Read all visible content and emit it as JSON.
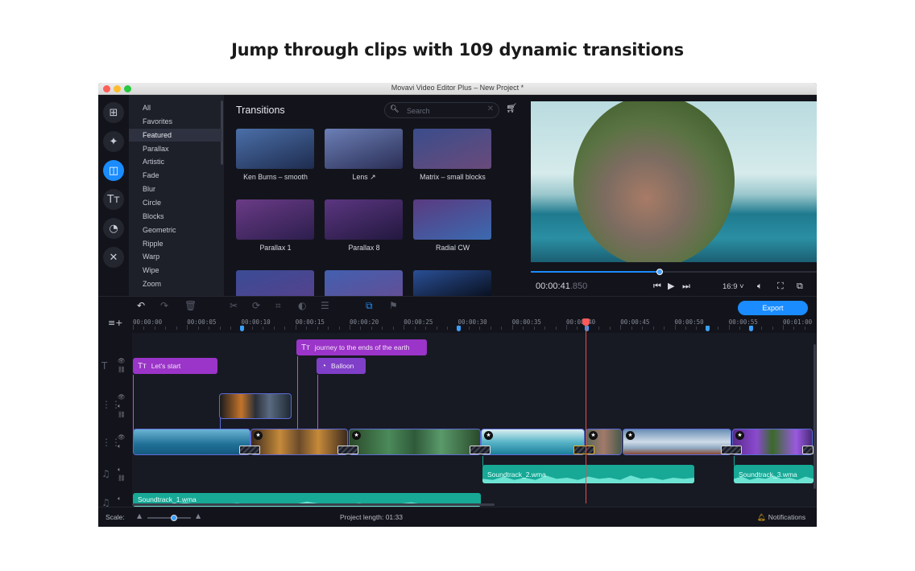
{
  "headline": "Jump through clips with 109 dynamic transitions",
  "window": {
    "title": "Movavi Video Editor Plus – New Project *"
  },
  "rail": [
    {
      "name": "import-icon",
      "glyph": "⊞",
      "active": false
    },
    {
      "name": "magic-wand-icon",
      "glyph": "✦",
      "active": false
    },
    {
      "name": "transitions-icon",
      "glyph": "◫",
      "active": true
    },
    {
      "name": "titles-icon",
      "glyph": "Tт",
      "active": false
    },
    {
      "name": "stickers-icon",
      "glyph": "◔",
      "active": false
    },
    {
      "name": "tools-icon",
      "glyph": "✕",
      "active": false
    }
  ],
  "categories": [
    "All",
    "Favorites",
    "Featured",
    "Parallax",
    "Artistic",
    "Fade",
    "Blur",
    "Circle",
    "Blocks",
    "Geometric",
    "Ripple",
    "Warp",
    "Wipe",
    "Zoom"
  ],
  "active_category": "Featured",
  "panel": {
    "title": "Transitions",
    "search_placeholder": "Search",
    "search_value": "",
    "thumbnails": [
      {
        "label": "Ken Burns – smooth",
        "colors": [
          "#4b6fa8",
          "#1e2c4f"
        ]
      },
      {
        "label": "Lens ↗",
        "colors": [
          "#6c7fb6",
          "#2a2e55"
        ]
      },
      {
        "label": "Matrix – small blocks",
        "colors": [
          "#3a4d8c",
          "#6a4a7a"
        ]
      },
      {
        "label": "Parallax 1",
        "colors": [
          "#6a3b86",
          "#2c1e4d"
        ]
      },
      {
        "label": "Parallax 8",
        "colors": [
          "#5b3680",
          "#22183f"
        ]
      },
      {
        "label": "Radial CW",
        "colors": [
          "#5a3a80",
          "#3b6ab0"
        ]
      },
      {
        "label": "",
        "colors": [
          "#3a4c96",
          "#5b3f8a"
        ]
      },
      {
        "label": "",
        "colors": [
          "#4260b0",
          "#6a4a90"
        ]
      },
      {
        "label": "",
        "colors": [
          "#2a4f96",
          "#000000"
        ]
      }
    ]
  },
  "preview": {
    "timecode": "00:00:41",
    "timecode_ms": ".850",
    "progress": 0.45,
    "aspect": "16:9"
  },
  "toolbar": {
    "export_label": "Export"
  },
  "ruler": {
    "ticks": [
      "00:00:00",
      "00:00:05",
      "00:00:10",
      "00:00:15",
      "00:00:20",
      "00:00:25",
      "00:00:30",
      "00:00:35",
      "00:00:40",
      "00:00:45",
      "00:00:50",
      "00:00:55",
      "00:01:00"
    ],
    "marker_seconds": [
      10,
      30,
      41.85,
      53,
      57
    ]
  },
  "timeline": {
    "titles": [
      {
        "label": "Let's start",
        "type": "title"
      },
      {
        "label": "journey to the ends of the earth",
        "type": "title"
      },
      {
        "label": "Balloon",
        "type": "sticker"
      }
    ],
    "audio": [
      {
        "label": "Soundtrack_1.wma"
      },
      {
        "label": "Soundtrack_2.wma"
      },
      {
        "label": "Soundtrack_3.wma"
      }
    ],
    "playhead_seconds": 41.85
  },
  "status": {
    "scale_label": "Scale:",
    "scale_value": 0.62,
    "project_length": "Project length:  01:33",
    "notifications": "Notifications"
  }
}
